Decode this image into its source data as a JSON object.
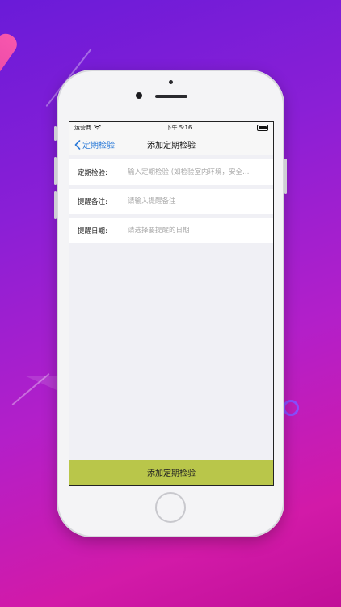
{
  "status_bar": {
    "carrier": "运营商",
    "time": "下午 5:16"
  },
  "nav": {
    "back_label": "定期检验",
    "title": "添加定期检验"
  },
  "form": {
    "fields": [
      {
        "label": "定期检验:",
        "placeholder": "输入定期检验 (如检验室内环境，安全…",
        "value": ""
      },
      {
        "label": "提醒备注:",
        "placeholder": "请输入提醒备注",
        "value": ""
      },
      {
        "label": "提醒日期:",
        "placeholder": "请选择要提醒的日期",
        "value": ""
      }
    ]
  },
  "submit_label": "添加定期检验",
  "colors": {
    "accent": "#2c7bd8",
    "submit_bg": "#b9c64a",
    "background_gradient_start": "#6a1bd8",
    "background_gradient_end": "#c10f98"
  }
}
